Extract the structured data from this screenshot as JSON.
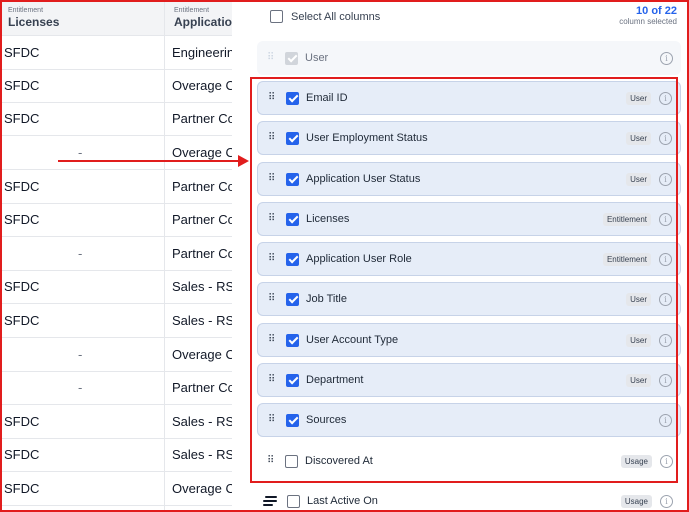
{
  "table": {
    "columns": [
      {
        "category": "Entitlement",
        "name": "Licenses"
      },
      {
        "category": "Entitlement",
        "name": "Application"
      }
    ],
    "rows": [
      {
        "license": "SFDC",
        "application": "Engineerin"
      },
      {
        "license": "SFDC",
        "application": "Overage C"
      },
      {
        "license": "SFDC",
        "application": "Partner Co"
      },
      {
        "license": "-",
        "application": "Overage C"
      },
      {
        "license": "SFDC",
        "application": "Partner Co"
      },
      {
        "license": "SFDC",
        "application": "Partner Co"
      },
      {
        "license": "-",
        "application": "Partner Co"
      },
      {
        "license": "SFDC",
        "application": "Sales - RS"
      },
      {
        "license": "SFDC",
        "application": "Sales - RS"
      },
      {
        "license": "-",
        "application": "Overage C"
      },
      {
        "license": "-",
        "application": "Partner Co"
      },
      {
        "license": "SFDC",
        "application": "Sales - RS"
      },
      {
        "license": "SFDC",
        "application": "Sales - RS"
      },
      {
        "license": "SFDC",
        "application": "Overage C"
      }
    ]
  },
  "panel": {
    "select_all_label": "Select All columns",
    "count": "10 of 22",
    "count_sub": "column selected",
    "items": [
      {
        "label": "User",
        "tag": "",
        "checked": true,
        "locked": true
      },
      {
        "label": "Email ID",
        "tag": "User",
        "checked": true
      },
      {
        "label": "User Employment Status",
        "tag": "User",
        "checked": true
      },
      {
        "label": "Application User Status",
        "tag": "User",
        "checked": true
      },
      {
        "label": "Licenses",
        "tag": "Entitlement",
        "checked": true
      },
      {
        "label": "Application User Role",
        "tag": "Entitlement",
        "checked": true
      },
      {
        "label": "Job Title",
        "tag": "User",
        "checked": true
      },
      {
        "label": "User Account Type",
        "tag": "User",
        "checked": true
      },
      {
        "label": "Department",
        "tag": "User",
        "checked": true
      },
      {
        "label": "Sources",
        "tag": "",
        "checked": true
      },
      {
        "label": "Discovered At",
        "tag": "Usage",
        "checked": false
      },
      {
        "label": "Last Active On",
        "tag": "Usage",
        "checked": false
      }
    ]
  },
  "colors": {
    "accent": "#2563eb",
    "annotation": "#e11d1d",
    "selected_row_bg": "#e6edf8"
  },
  "icons": {
    "drag": "drag-handle-icon",
    "info": "info-icon",
    "reorder": "reorder-lines-icon"
  }
}
